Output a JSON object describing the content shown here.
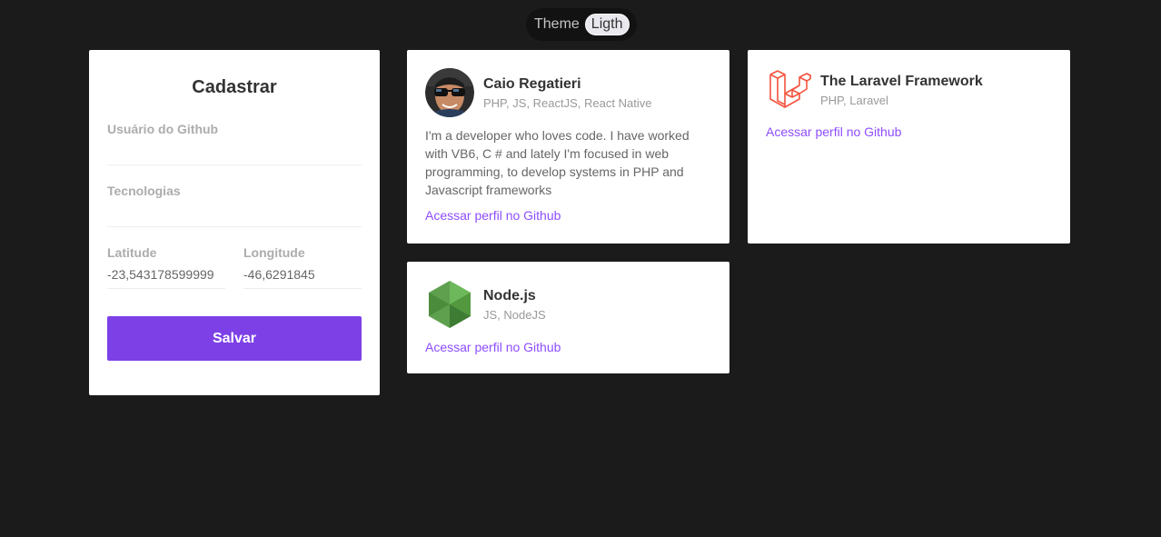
{
  "theme": {
    "label": "Theme",
    "toggle": "Ligth"
  },
  "form": {
    "title": "Cadastrar",
    "github_label": "Usuário do Github",
    "github_value": "",
    "techs_label": "Tecnologias",
    "techs_value": "",
    "latitude_label": "Latitude",
    "latitude_value": "-23,543178599999",
    "longitude_label": "Longitude",
    "longitude_value": "-46,6291845",
    "submit_label": "Salvar"
  },
  "devs": [
    {
      "name": "Caio Regatieri",
      "techs": "PHP, JS, ReactJS, React Native",
      "bio": "I'm a developer who loves code. I have worked with VB6, C # and lately I'm focused in web programming, to develop systems in PHP and Javascript frameworks",
      "link_label": "Acessar perfil no Github",
      "avatar_icon": "person-photo"
    },
    {
      "name": "The Laravel Framework",
      "techs": "PHP, Laravel",
      "link_label": "Acessar perfil no Github",
      "avatar_icon": "laravel-logo"
    },
    {
      "name": "Node.js",
      "techs": "JS, NodeJS",
      "link_label": "Acessar perfil no Github",
      "avatar_icon": "nodejs-logo"
    }
  ],
  "colors": {
    "accent": "#7d40e7",
    "link": "#8e4dff",
    "background": "#1c1b1b"
  }
}
